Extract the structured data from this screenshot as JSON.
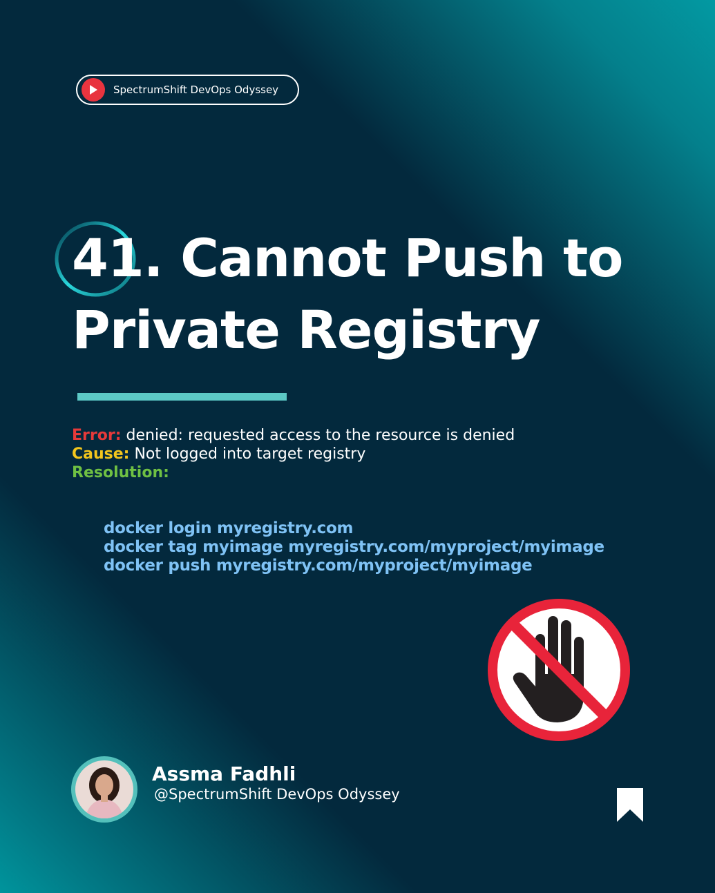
{
  "badge": {
    "label": "SpectrumShift DevOps Odyssey"
  },
  "title": {
    "line1": "41. Cannot Push to",
    "line2": "Private Registry"
  },
  "info": {
    "error_key": "Error:",
    "error_value": "denied: requested access to the resource is denied",
    "cause_key": "Cause:",
    "cause_value": "Not logged into target registry",
    "resolution_key": "Resolution:"
  },
  "commands": [
    "docker login myregistry.com",
    "docker tag myimage myregistry.com/myproject/myimage",
    "docker push myregistry.com/myproject/myimage"
  ],
  "author": {
    "name": "Assma Fadhli",
    "handle": "@SpectrumShift DevOps Odyssey"
  },
  "icons": {
    "badge": "play-icon",
    "illustration": "stop-hand-icon",
    "avatar": "avatar",
    "save": "bookmark-icon"
  },
  "colors": {
    "background": "#03293d",
    "accent_teal": "#5cc9c6",
    "error": "#e63a3a",
    "cause": "#f3c61d",
    "resolution": "#6fc043",
    "code": "#7fc2f5",
    "stop_red": "#e8243a"
  }
}
